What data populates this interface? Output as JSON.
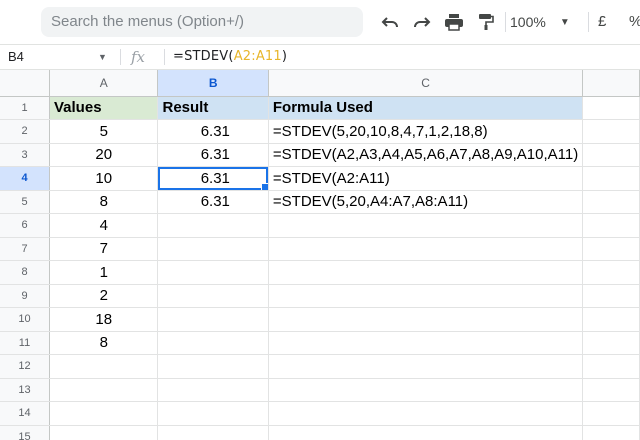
{
  "toolbar": {
    "search_placeholder": "Search the menus (Option+/)",
    "zoom": "100%",
    "currency": "£",
    "percent": "%",
    "icons": [
      "undo-icon",
      "redo-icon",
      "print-icon",
      "paint-format-icon"
    ]
  },
  "formula_bar": {
    "name_box": "B4",
    "fx": "fx",
    "formula_prefix": "=STDEV(",
    "formula_ref": "A2:A11",
    "formula_suffix": ")"
  },
  "colors": {
    "header_green": "#d9ead3",
    "header_blue": "#cfe2f3",
    "selection": "#1a73e8",
    "range_ref": "#e8b62a"
  },
  "sheet": {
    "columns": [
      "A",
      "B",
      "C"
    ],
    "selected_column": "B",
    "selected_row": "4",
    "row_numbers": [
      "1",
      "2",
      "3",
      "4",
      "5",
      "6",
      "7",
      "8",
      "9",
      "10",
      "11",
      "12",
      "13",
      "14",
      "15"
    ],
    "header_row": {
      "a": "Values",
      "b": "Result",
      "c": "Formula Used"
    },
    "rows": [
      {
        "a": "5",
        "b": "6.31",
        "c": "=STDEV(5,20,10,8,4,7,1,2,18,8)"
      },
      {
        "a": "20",
        "b": "6.31",
        "c": "=STDEV(A2,A3,A4,A5,A6,A7,A8,A9,A10,A11)"
      },
      {
        "a": "10",
        "b": "6.31",
        "c": "=STDEV(A2:A11)"
      },
      {
        "a": "8",
        "b": "6.31",
        "c": "=STDEV(5,20,A4:A7,A8:A11)"
      },
      {
        "a": "4",
        "b": "",
        "c": ""
      },
      {
        "a": "7",
        "b": "",
        "c": ""
      },
      {
        "a": "1",
        "b": "",
        "c": ""
      },
      {
        "a": "2",
        "b": "",
        "c": ""
      },
      {
        "a": "18",
        "b": "",
        "c": ""
      },
      {
        "a": "8",
        "b": "",
        "c": ""
      },
      {
        "a": "",
        "b": "",
        "c": ""
      },
      {
        "a": "",
        "b": "",
        "c": ""
      },
      {
        "a": "",
        "b": "",
        "c": ""
      },
      {
        "a": "",
        "b": "",
        "c": ""
      }
    ]
  }
}
